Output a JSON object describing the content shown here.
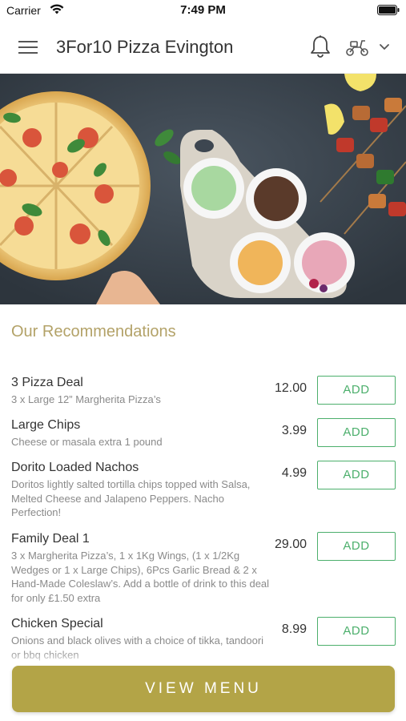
{
  "status_bar": {
    "carrier": "Carrier",
    "time": "7:49 PM"
  },
  "header": {
    "title": "3For10 Pizza Evington"
  },
  "section": {
    "title": "Our Recommendations"
  },
  "items": [
    {
      "name": "3 Pizza Deal",
      "description": "3 x Large 12” Margherita Pizza’s",
      "price": "12.00",
      "add_label": "ADD"
    },
    {
      "name": "Large Chips",
      "description": "Cheese or masala extra 1 pound",
      "price": "3.99",
      "add_label": "ADD"
    },
    {
      "name": "Dorito Loaded Nachos",
      "description": "Doritos lightly salted tortilla chips topped with Salsa, Melted Cheese and Jalapeno Peppers. Nacho Perfection!",
      "price": "4.99",
      "add_label": "ADD"
    },
    {
      "name": "Family Deal 1",
      "description": "3 x Margherita Pizza’s, 1 x 1Kg Wings, (1 x 1/2Kg Wedges or 1 x Large Chips), 6Pcs Garlic Bread & 2 x Hand-Made Coleslaw’s. Add a bottle of drink to this deal for only £1.50 extra",
      "price": "29.00",
      "add_label": "ADD"
    },
    {
      "name": "Chicken Special",
      "description": "Onions and black olives with a choice of tikka, tandoori or bbq chicken",
      "price": "8.99",
      "add_label": "ADD"
    }
  ],
  "footer": {
    "view_menu_label": "VIEW MENU"
  },
  "colors": {
    "accent_gold": "#b3a447",
    "section_title": "#b3a268",
    "add_green": "#4caf6c"
  },
  "icons": [
    "wifi-icon",
    "battery-icon",
    "hamburger-menu-icon",
    "bell-icon",
    "scooter-icon",
    "chevron-down-icon"
  ]
}
